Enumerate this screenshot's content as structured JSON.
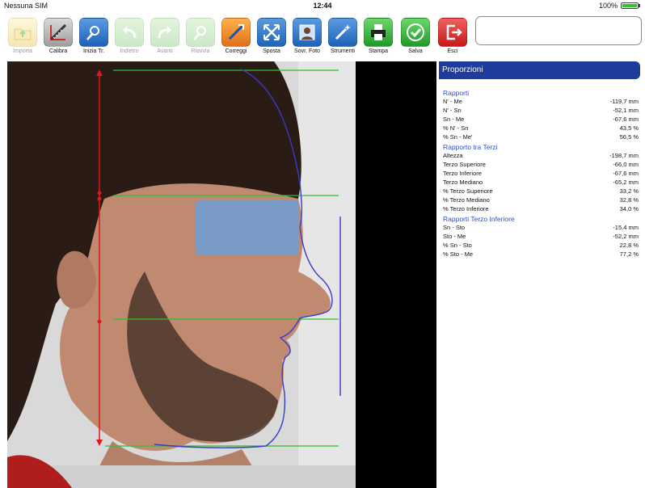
{
  "status": {
    "carrier": "Nessuna SIM",
    "time": "12:44",
    "battery": "100%"
  },
  "toolbar": {
    "import_label": "Importa",
    "calibra_label": "Calibra",
    "inizia_label": "Inizia Tr.",
    "indietro_label": "Indietro",
    "avanti_label": "Avanti",
    "riavvia_label": "Riavvia",
    "correggi_label": "Correggi",
    "sposta_label": "Sposta",
    "sovr_label": "Sovr. Foto",
    "strumenti_label": "Strumenti",
    "stampa_label": "Stampa",
    "salva_label": "Salva",
    "esci_label": "Esci"
  },
  "panel": {
    "title": "Proporzioni",
    "sections": [
      {
        "title": "Rapporti",
        "rows": [
          {
            "label": "N' - Me",
            "value": "-119,7 mm"
          },
          {
            "label": "N' - Sn",
            "value": "-52,1 mm"
          },
          {
            "label": "Sn - Me",
            "value": "-67,6 mm"
          },
          {
            "label": "% N' - Sn",
            "value": "43,5 %"
          },
          {
            "label": "% Sn - Me'",
            "value": "56,5 %"
          }
        ]
      },
      {
        "title": "Rapporto tra Terzi",
        "rows": [
          {
            "label": "Altezza",
            "value": "-198,7 mm"
          },
          {
            "label": "Terzo Superiore",
            "value": "-66,0 mm"
          },
          {
            "label": "Terzo Inferiore",
            "value": "-67,6 mm"
          },
          {
            "label": "Terzo Mediano",
            "value": "-65,2 mm"
          },
          {
            "label": "% Terzo Superiore",
            "value": "33,2 %"
          },
          {
            "label": "% Terzo Mediano",
            "value": "32,8 %"
          },
          {
            "label": "% Terzo Inferiore",
            "value": "34,0 %"
          }
        ]
      },
      {
        "title": "Rapporti Terzo Inferiore",
        "rows": [
          {
            "label": "Sn - Sto",
            "value": "-15,4 mm"
          },
          {
            "label": "Sto - Me",
            "value": "-52,2 mm"
          },
          {
            "label": "% Sn - Sto",
            "value": "22,8 %"
          },
          {
            "label": "% Sto - Me",
            "value": "77,2 %"
          }
        ]
      }
    ]
  },
  "colors": {
    "accent": "#1d3c9c",
    "section": "#2a4fd6",
    "measure_line": "#e01818",
    "guide_line": "#2fbf2f",
    "profile_line": "#3a3acc"
  }
}
